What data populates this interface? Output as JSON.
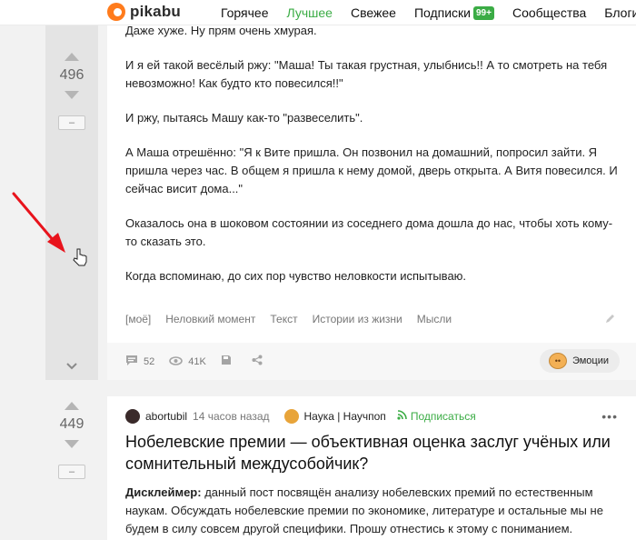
{
  "header": {
    "logo_text": "pikabu",
    "nav": [
      {
        "label": "Горячее",
        "active": false
      },
      {
        "label": "Лучшее",
        "active": true
      },
      {
        "label": "Свежее",
        "active": false
      },
      {
        "label": "Подписки",
        "badge": "99+",
        "active": false
      },
      {
        "label": "Сообщества",
        "active": false
      },
      {
        "label": "Блоги",
        "active": false
      }
    ]
  },
  "story1": {
    "rating": "496",
    "minus_label": "–",
    "paragraphs": [
      "Даже хуже. Ну прям очень хмурая.",
      "И я ей такой весёлый ржу: \"Маша! Ты такая грустная, улыбнись!! А то смотреть на тебя невозможно! Как будто кто повесился!!\"",
      "И ржу, пытаясь Машу как-то \"развеселить\".",
      "А Маша отрешённо: \"Я к Вите пришла. Он позвонил на домашний, попросил зайти. Я пришла через час. В общем я пришла к нему домой, дверь открыта. А Витя повесился. И сейчас висит дома...\"",
      "Оказалось она в шоковом состоянии из соседнего дома дошла до нас, чтобы хоть кому-то сказать это.",
      "Когда вспоминаю, до сих пор чувство неловкости испытываю."
    ],
    "tags": [
      "[моё]",
      "Неловкий момент",
      "Текст",
      "Истории из жизни",
      "Мысли"
    ],
    "comments_count": "52",
    "views_count": "41K",
    "emotions_label": "Эмоции"
  },
  "story2": {
    "rating": "449",
    "minus_label": "–",
    "author": "abortubil",
    "time": "14 часов назад",
    "community": "Наука | Научпоп",
    "subscribe_label": "Подписаться",
    "more_label": "•••",
    "title": "Нобелевские премии — объективная оценка заслуг учёных или сомнительный междусобойчик?",
    "body_bold": "Дисклеймер:",
    "body_rest": " данный пост посвящён анализу нобелевских премий по естественным наукам. Обсуждать нобелевские премии по экономике, литературе и остальные мы не будем в силу совсем другой специфики. Прошу отнестись к этому с пониманием."
  },
  "colors": {
    "accent": "#3bac45",
    "logo": "#ff7b1c",
    "arrow": "#e8131c"
  },
  "icons": [
    "comment-icon",
    "eye-icon",
    "save-icon",
    "share-icon",
    "edit-icon",
    "chevron-down-icon",
    "arrow-annotation",
    "hand-cursor-icon"
  ]
}
